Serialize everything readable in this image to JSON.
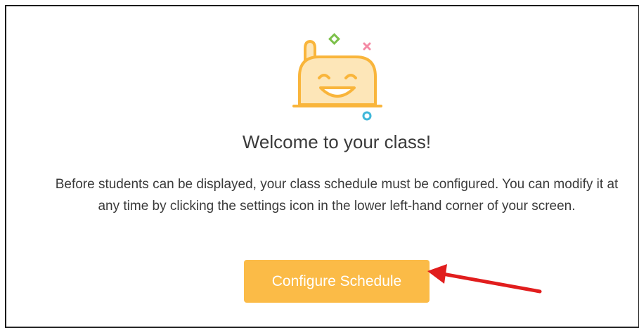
{
  "welcome": {
    "title": "Welcome to your class!",
    "message": "Before students can be displayed, your class schedule must be configured. You can modify it at any time by clicking the settings icon in the lower left-hand corner of your screen.",
    "button_label": "Configure Schedule"
  },
  "colors": {
    "accent": "#fbbb47",
    "mascot_fill": "#fde6b8",
    "mascot_stroke": "#f9b53b",
    "annotation_arrow": "#e11d1d"
  },
  "icons": {
    "mascot": "smiling-mascot-icon",
    "arrow": "red-arrow-annotation"
  }
}
